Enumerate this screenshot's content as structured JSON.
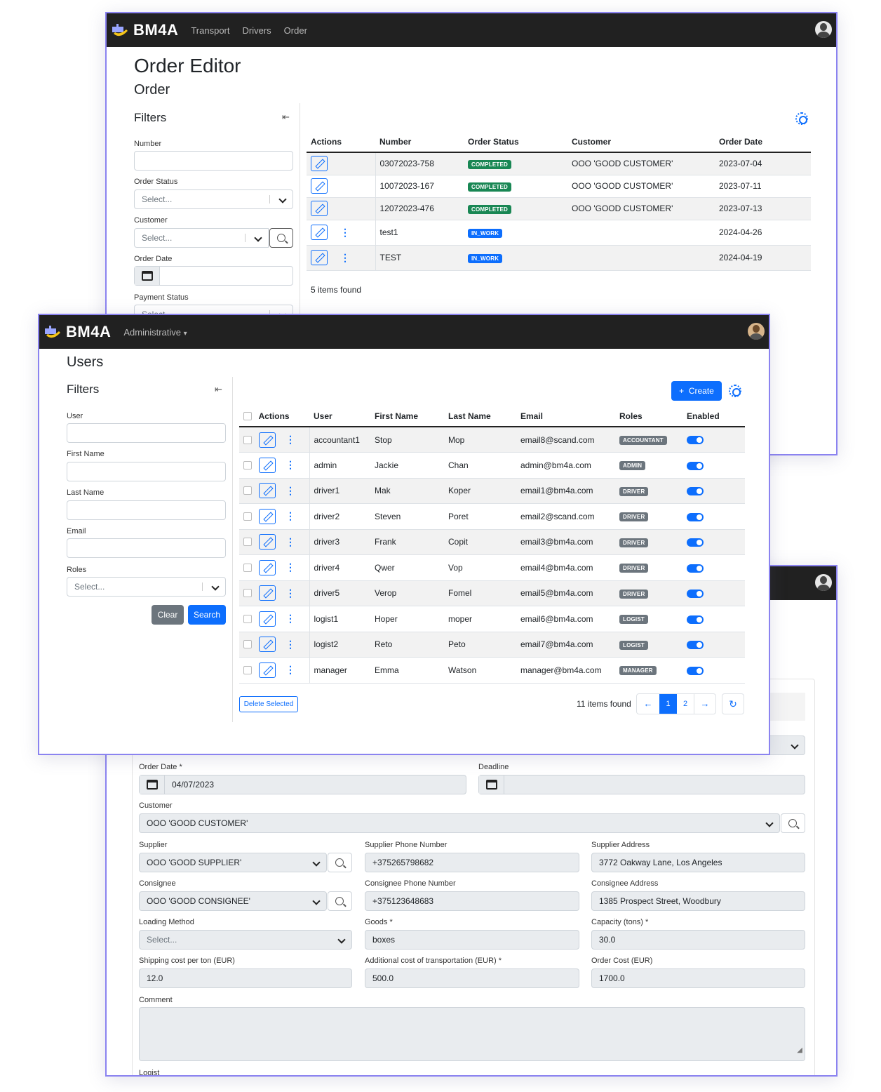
{
  "brand": "BM4A",
  "order_window": {
    "nav": [
      "Transport",
      "Drivers",
      "Order"
    ],
    "title": "Order Editor",
    "subtitle": "Order",
    "filters_title": "Filters",
    "filters": {
      "number_label": "Number",
      "order_status_label": "Order Status",
      "order_status_placeholder": "Select...",
      "customer_label": "Customer",
      "customer_placeholder": "Select...",
      "order_date_label": "Order Date",
      "payment_status_label": "Payment Status",
      "payment_status_placeholder": "Select..."
    },
    "columns": [
      "Actions",
      "Number",
      "Order Status",
      "Customer",
      "Order Date"
    ],
    "rows": [
      {
        "number": "03072023-758",
        "status": "COMPLETED",
        "customer": "OOO 'GOOD CUSTOMER'",
        "date": "2023-07-04"
      },
      {
        "number": "10072023-167",
        "status": "COMPLETED",
        "customer": "OOO 'GOOD CUSTOMER'",
        "date": "2023-07-11"
      },
      {
        "number": "12072023-476",
        "status": "COMPLETED",
        "customer": "OOO 'GOOD CUSTOMER'",
        "date": "2023-07-13"
      },
      {
        "number": "test1",
        "status": "IN_WORK",
        "customer": "",
        "date": "2024-04-26"
      },
      {
        "number": "TEST",
        "status": "IN_WORK",
        "customer": "",
        "date": "2024-04-19"
      }
    ],
    "items_found": "5 items found"
  },
  "users_window": {
    "nav_menu": "Administrative",
    "title": "Users",
    "filters_title": "Filters",
    "filters": {
      "user_label": "User",
      "first_name_label": "First Name",
      "last_name_label": "Last Name",
      "email_label": "Email",
      "roles_label": "Roles",
      "roles_placeholder": "Select...",
      "clear_label": "Clear",
      "search_label": "Search"
    },
    "create_label": "Create",
    "columns": [
      "Actions",
      "User",
      "First Name",
      "Last Name",
      "Email",
      "Roles",
      "Enabled"
    ],
    "rows": [
      {
        "user": "accountant1",
        "first": "Stop",
        "last": "Mop",
        "email": "email8@scand.com",
        "role": "ACCOUNTANT"
      },
      {
        "user": "admin",
        "first": "Jackie",
        "last": "Chan",
        "email": "admin@bm4a.com",
        "role": "ADMIN"
      },
      {
        "user": "driver1",
        "first": "Mak",
        "last": "Koper",
        "email": "email1@bm4a.com",
        "role": "DRIVER"
      },
      {
        "user": "driver2",
        "first": "Steven",
        "last": "Poret",
        "email": "email2@scand.com",
        "role": "DRIVER"
      },
      {
        "user": "driver3",
        "first": "Frank",
        "last": "Copit",
        "email": "email3@bm4a.com",
        "role": "DRIVER"
      },
      {
        "user": "driver4",
        "first": "Qwer",
        "last": "Vop",
        "email": "email4@bm4a.com",
        "role": "DRIVER"
      },
      {
        "user": "driver5",
        "first": "Verop",
        "last": "Fomel",
        "email": "email5@bm4a.com",
        "role": "DRIVER"
      },
      {
        "user": "logist1",
        "first": "Hoper",
        "last": "moper",
        "email": "email6@bm4a.com",
        "role": "LOGIST"
      },
      {
        "user": "logist2",
        "first": "Reto",
        "last": "Peto",
        "email": "email7@bm4a.com",
        "role": "LOGIST"
      },
      {
        "user": "manager",
        "first": "Emma",
        "last": "Watson",
        "email": "manager@bm4a.com",
        "role": "MANAGER"
      }
    ],
    "delete_selected_label": "Delete Selected",
    "items_found": "11 items found",
    "pagination": {
      "prev": "←",
      "pages": [
        "1",
        "2"
      ],
      "current": "1",
      "next": "→"
    }
  },
  "form_window": {
    "order_date_label": "Order Date *",
    "order_date_value": "04/07/2023",
    "deadline_label": "Deadline",
    "customer_label": "Customer",
    "customer_value": "OOO 'GOOD CUSTOMER'",
    "supplier_label": "Supplier",
    "supplier_value": "OOO 'GOOD SUPPLIER'",
    "supplier_phone_label": "Supplier Phone Number",
    "supplier_phone_value": "+375265798682",
    "supplier_address_label": "Supplier Address",
    "supplier_address_value": "3772 Oakway Lane, Los Angeles",
    "consignee_label": "Consignee",
    "consignee_value": "OOO 'GOOD CONSIGNEE'",
    "consignee_phone_label": "Consignee Phone Number",
    "consignee_phone_value": "+375123648683",
    "consignee_address_label": "Consignee Address",
    "consignee_address_value": "1385 Prospect Street, Woodbury",
    "loading_method_label": "Loading Method",
    "loading_method_placeholder": "Select...",
    "goods_label": "Goods *",
    "goods_value": "boxes",
    "capacity_label": "Capacity (tons) *",
    "capacity_value": "30.0",
    "shipping_cost_label": "Shipping cost per ton (EUR)",
    "shipping_cost_value": "12.0",
    "additional_cost_label": "Additional cost of transportation (EUR) *",
    "additional_cost_value": "500.0",
    "order_cost_label": "Order Cost (EUR)",
    "order_cost_value": "1700.0",
    "comment_label": "Comment",
    "logist_label": "Logist"
  },
  "colors": {
    "accent": "#0d6efd",
    "frame": "#8b83f0",
    "topbar": "#212121",
    "completed": "#198754",
    "role_badge": "#6c757d"
  }
}
